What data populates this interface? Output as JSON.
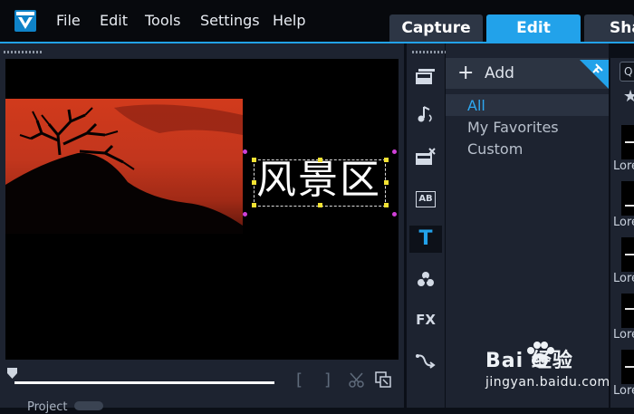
{
  "menu": [
    "File",
    "Edit",
    "Tools",
    "Settings",
    "Help"
  ],
  "tabs": {
    "capture": "Capture",
    "edit": "Edit",
    "share": "Sha"
  },
  "preview": {
    "title_text": "风景区"
  },
  "controls": {
    "mark_in": "[",
    "mark_out": "]",
    "project_label": "Project"
  },
  "rail": {
    "title_tool": "T",
    "fx": "FX",
    "ab": "AB"
  },
  "library": {
    "add_label": "Add",
    "items": [
      "All",
      "My Favorites",
      "Custom"
    ],
    "selected": "All"
  },
  "thumbnails": {
    "labels": [
      "Lore",
      "Lore",
      "Lore",
      "Lore",
      "Lore"
    ],
    "search_glyph": "Q"
  },
  "watermark": {
    "main": "Bai  经验",
    "sub": "jingyan.baidu.com"
  },
  "colors": {
    "accent": "#22a2ea",
    "panel": "#1d2330",
    "background": "#0b0f17"
  }
}
